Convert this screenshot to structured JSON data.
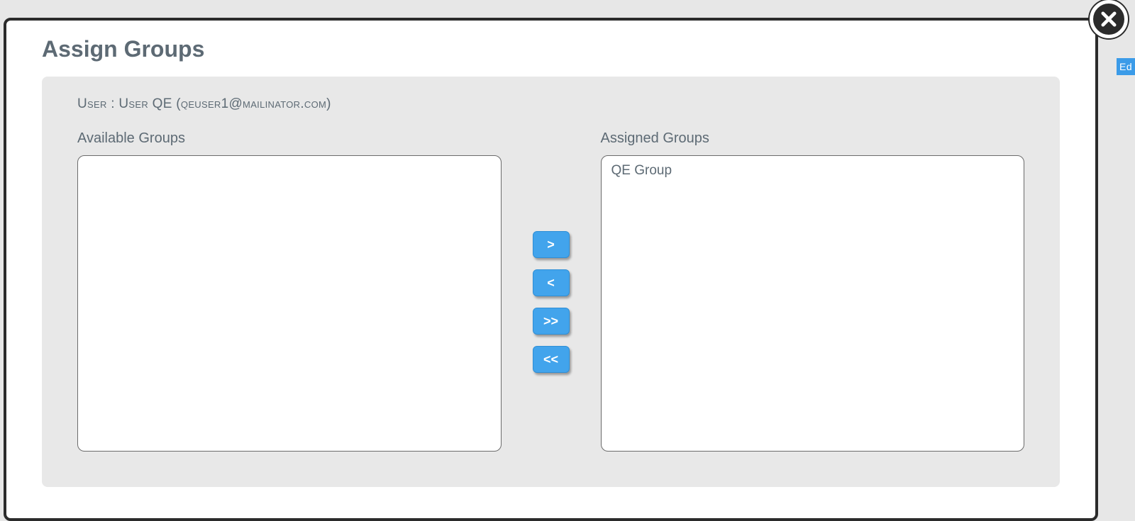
{
  "background": {
    "edit_fragment": "Ed"
  },
  "modal": {
    "title": "Assign Groups",
    "user_label_prefix": "User : ",
    "user_display_name": "User QE",
    "user_email": "qeuser1@mailinator.com",
    "available": {
      "label": "Available Groups",
      "items": []
    },
    "assigned": {
      "label": "Assigned Groups",
      "items": [
        "QE Group"
      ]
    },
    "controls": {
      "move_right": ">",
      "move_left": "<",
      "move_all_right": ">>",
      "move_all_left": "<<"
    }
  }
}
